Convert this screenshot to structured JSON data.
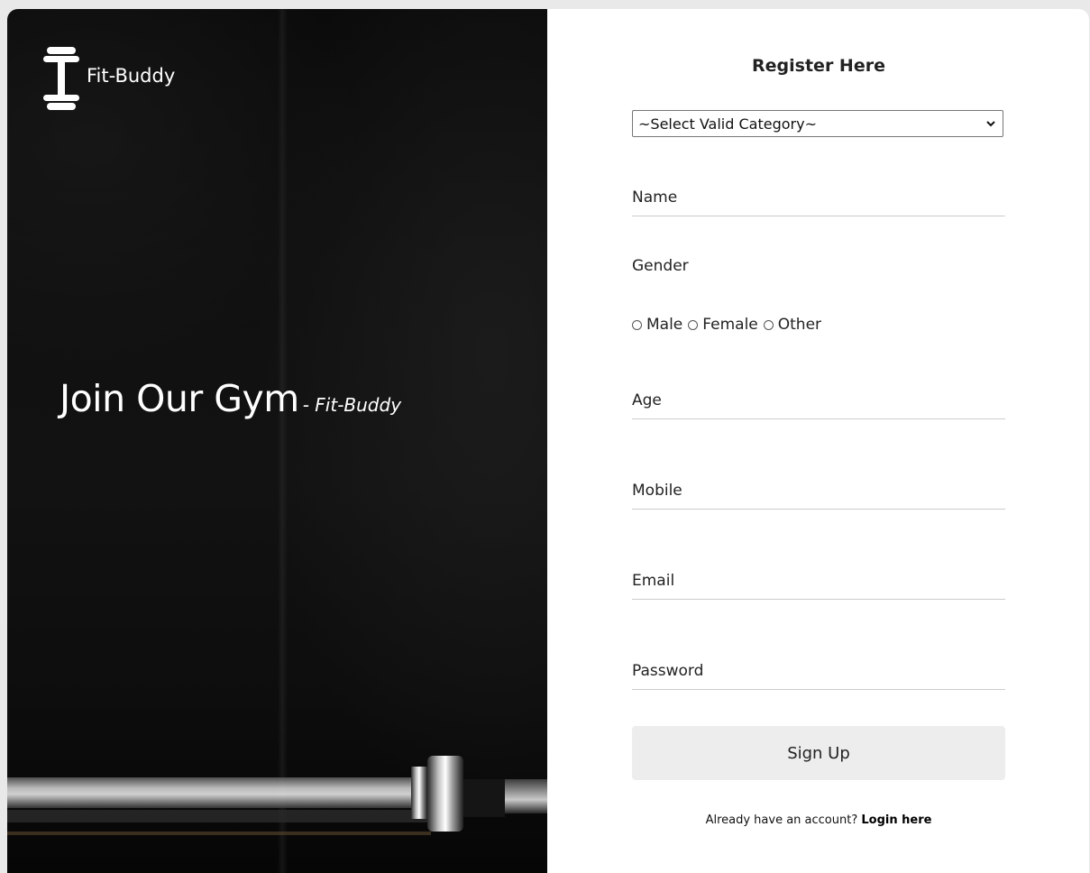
{
  "brand": {
    "name": "Fit-Buddy"
  },
  "hero": {
    "title": "Join Our Gym",
    "subtitle": "- Fit-Buddy"
  },
  "form": {
    "title": "Register Here",
    "category": {
      "selected": "~Select Valid Category~"
    },
    "fields": {
      "name_placeholder": "Name",
      "age_placeholder": "Age",
      "mobile_placeholder": "Mobile",
      "email_placeholder": "Email",
      "password_placeholder": "Password"
    },
    "gender": {
      "label": "Gender",
      "options": [
        "Male",
        "Female",
        "Other"
      ]
    },
    "submit_label": "Sign Up",
    "login_prompt": "Already have an account?",
    "login_link": "Login here"
  },
  "icons": {
    "brand": "dumbbell-icon",
    "select": "chevron-down-icon"
  },
  "colors": {
    "hero_background": "#0d0d0d",
    "button_background": "#ededed",
    "text": "#222222"
  }
}
